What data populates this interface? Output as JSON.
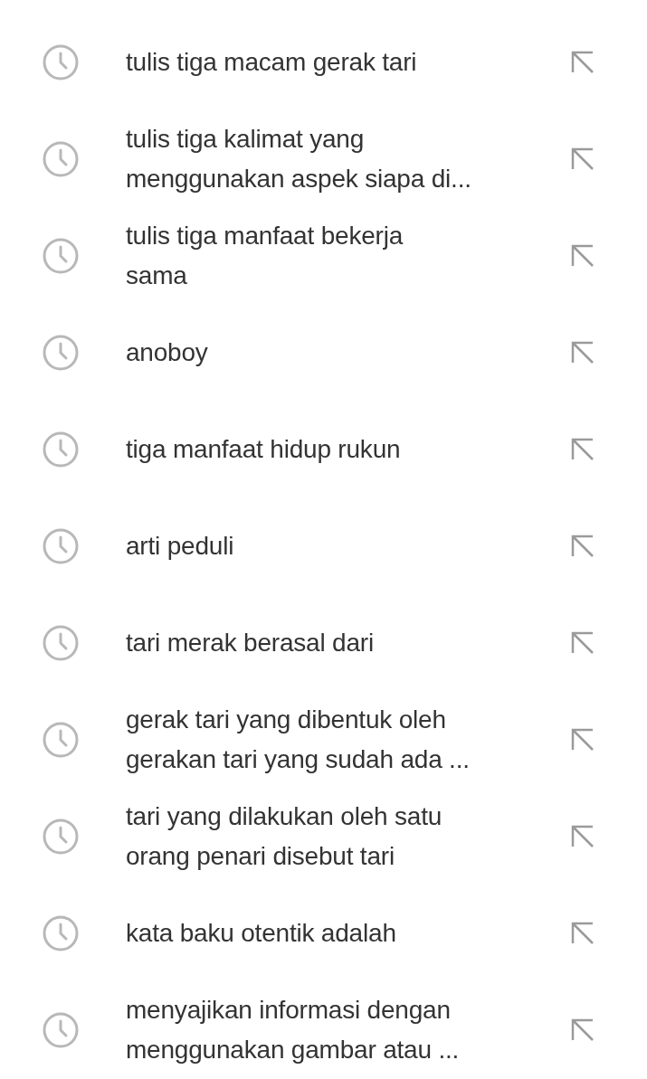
{
  "history": [
    {
      "lines": [
        "tulis tiga macam gerak tari"
      ]
    },
    {
      "lines": [
        "tulis tiga kalimat yang",
        "menggunakan aspek siapa di..."
      ]
    },
    {
      "lines": [
        "tulis tiga manfaat bekerja",
        "sama"
      ]
    },
    {
      "lines": [
        "anoboy"
      ]
    },
    {
      "lines": [
        "tiga manfaat hidup rukun"
      ]
    },
    {
      "lines": [
        "arti peduli"
      ]
    },
    {
      "lines": [
        "tari merak berasal dari"
      ]
    },
    {
      "lines": [
        "gerak tari yang dibentuk oleh",
        "gerakan tari yang sudah ada ..."
      ]
    },
    {
      "lines": [
        "tari yang dilakukan oleh satu",
        "orang penari disebut tari"
      ]
    },
    {
      "lines": [
        "kata baku otentik adalah"
      ]
    },
    {
      "lines": [
        "menyajikan informasi dengan",
        "menggunakan gambar atau ..."
      ]
    }
  ]
}
